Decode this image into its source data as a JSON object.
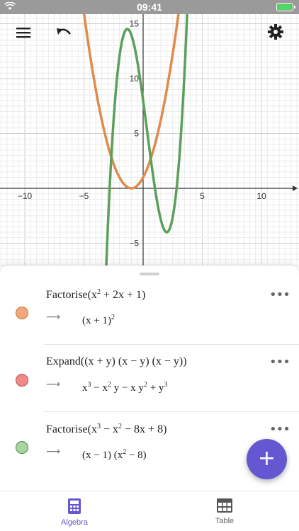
{
  "status_bar": {
    "time": "09:41"
  },
  "graph": {
    "x_ticks": [
      "−10",
      "−5",
      "5",
      "10"
    ],
    "y_ticks": [
      "15",
      "10",
      "5",
      "−5"
    ],
    "curves": [
      {
        "color": "#e08a4c",
        "expression": "(x + 1)^2"
      },
      {
        "color": "#5aa05a",
        "expression": "(x − 1)(x^2 − 8)"
      }
    ]
  },
  "algebra": {
    "rows": [
      {
        "color": "#f0a77c",
        "border": "#c9773e",
        "input_cmd": "Factorise(",
        "input_html": "x<span class=\"sub\">2</span> + 2x + 1)",
        "output_html": "(x + 1)<span class=\"sub\">2</span>"
      },
      {
        "color": "#ee8a8a",
        "border": "#c44a4a",
        "input_cmd": "Expand(",
        "input_html": "(x + y) (x − y) (x − y))",
        "output_html": "x<span class=\"sub\">3</span> − x<span class=\"sub\">2</span> y − x y<span class=\"sub\">2</span> + y<span class=\"sub\">3</span>"
      },
      {
        "color": "#a8d4a0",
        "border": "#4a8f45",
        "input_cmd": "Factorise(",
        "input_html": "x<span class=\"sub\">3</span> − x<span class=\"sub\">2</span> − 8x + 8)",
        "output_html": "(x − 1) (x<span class=\"sub\">2</span> − 8)"
      }
    ],
    "arrow": "⟶",
    "more": "•••"
  },
  "fab": {
    "label": "+"
  },
  "nav": {
    "algebra_label": "Algebra",
    "table_label": "Table"
  },
  "colors": {
    "accent": "#6557d2"
  }
}
